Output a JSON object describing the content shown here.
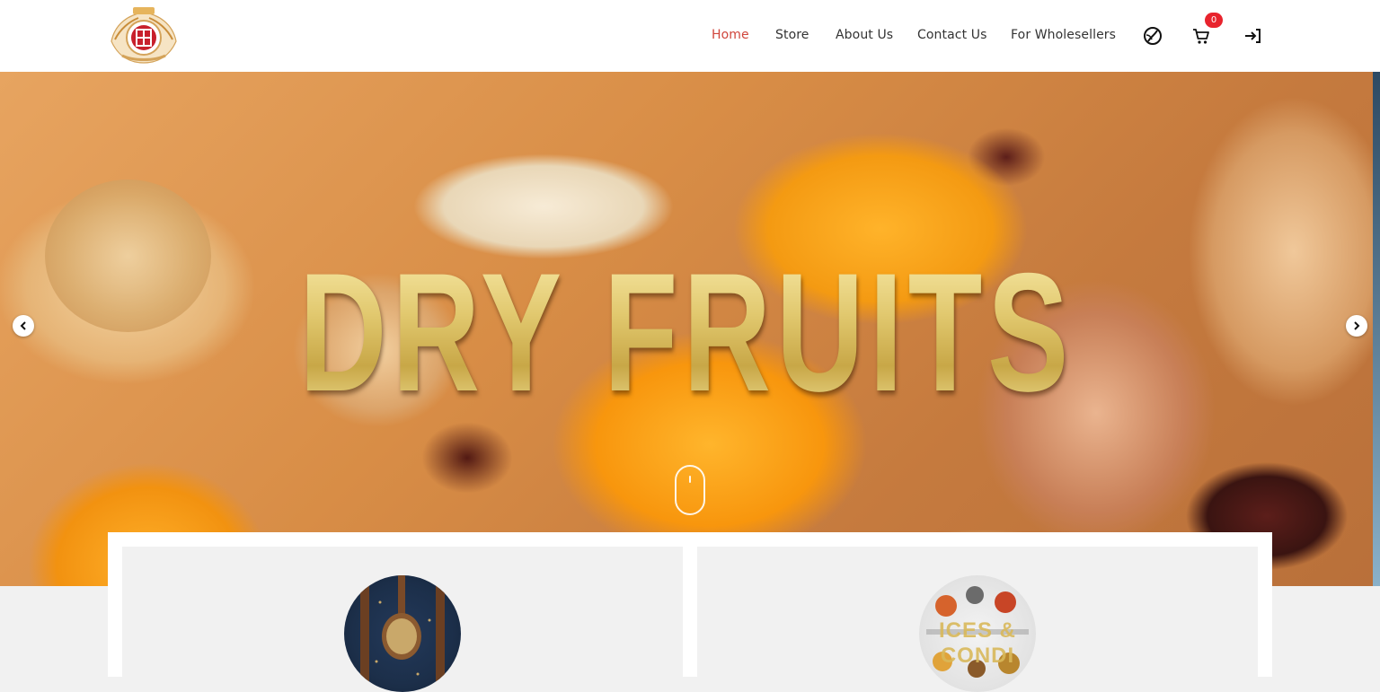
{
  "brand": {
    "logo_icon": "crest-logo"
  },
  "nav": {
    "items": [
      {
        "label": "Home",
        "active": true
      },
      {
        "label": "Store",
        "active": false
      },
      {
        "label": "About Us",
        "active": false
      },
      {
        "label": "Contact Us",
        "active": false
      },
      {
        "label": "For Wholesellers",
        "active": false
      }
    ],
    "icons": {
      "language": "globe-icon",
      "cart": "cart-icon",
      "login": "login-icon"
    },
    "cart_count": "0"
  },
  "hero": {
    "title": "DRY FRUITS",
    "prev_icon": "chevron-left-icon",
    "next_icon": "chevron-right-icon",
    "scroll_icon": "mouse-scroll-icon"
  },
  "categories": [
    {
      "image": "spoon-seeds-image",
      "overlay": ""
    },
    {
      "image": "spices-spoons-image",
      "overlay": "ICES & CONDI"
    }
  ],
  "colors": {
    "accent": "#d0453b",
    "badge": "#e8232d",
    "gold": "#e1c86e"
  }
}
